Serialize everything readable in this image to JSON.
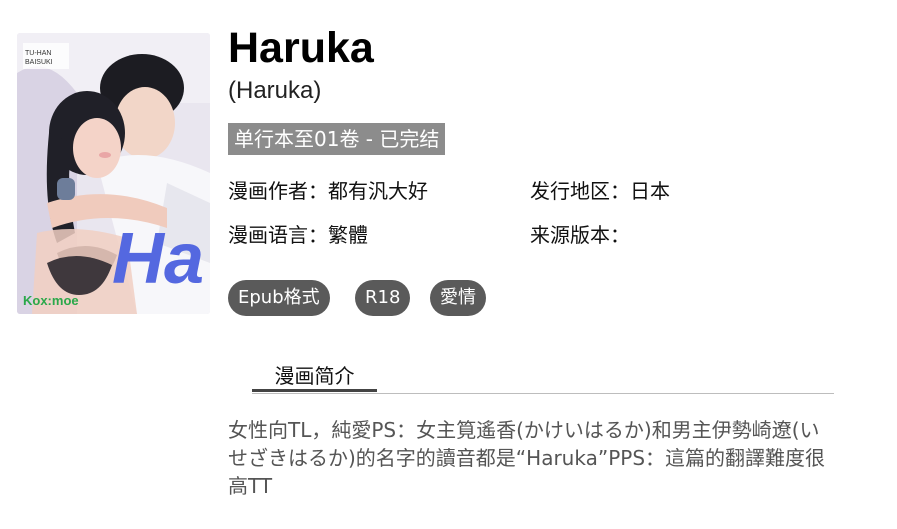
{
  "book": {
    "title": "Haruka",
    "subtitle": "(Haruka)",
    "status": "单行本至01卷 - 已完结"
  },
  "cover": {
    "watermark": "Kox:moe",
    "badge_top": "TU-HAN",
    "badge_bottom": "BAISUKI",
    "logo_text": "Ha",
    "colors": {
      "background": "#e9e6ef",
      "logo": "#5468e0",
      "watermark": "#2aa84a"
    }
  },
  "info": {
    "author": "漫画作者：都有汎大好",
    "region": "发行地区：日本",
    "language": "漫画语言：繁體",
    "source": "来源版本："
  },
  "tags": [
    "Epub格式",
    "R18",
    "愛情"
  ],
  "tabs": {
    "intro": "漫画简介"
  },
  "description": "女性向TL，純愛PS：女主筧遙香(かけいはるか)和男主伊勢崎遼(いせざきはるか)的名字的讀音都是“Haruka”PPS：這篇的翻譯難度很高TT"
}
